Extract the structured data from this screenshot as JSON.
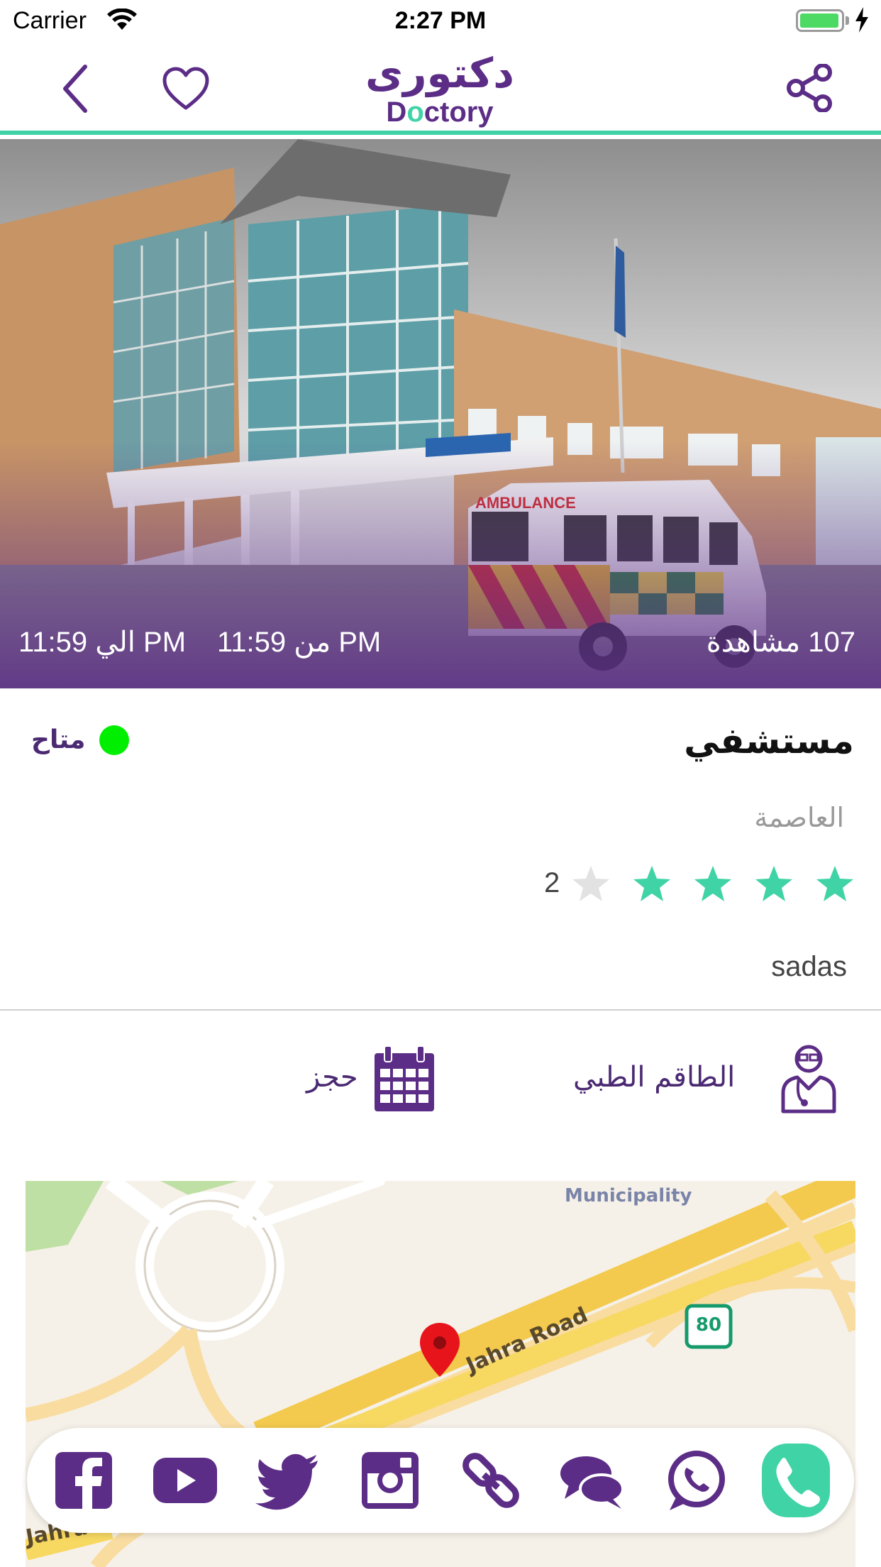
{
  "status_bar": {
    "carrier": "Carrier",
    "time": "2:27 PM"
  },
  "nav": {
    "logo_ar": "دكتورى",
    "logo_en_a": "D",
    "logo_en_dot": "o",
    "logo_en_b": "ctory",
    "icons": [
      "back-chevron-icon",
      "heart-icon",
      "share-icon"
    ]
  },
  "hero": {
    "hours_from": "من 11:59 PM",
    "hours_to": "الي 11:59 PM",
    "views": "107 مشاهدة"
  },
  "place": {
    "name": "مستشفي",
    "status": "متاح",
    "city": "العاصمة",
    "rating_value": 4,
    "rating_max": 5,
    "rating_count": "2",
    "description": "sadas"
  },
  "actions": {
    "staff_label": "الطاقم الطبي",
    "booking_label": "حجز"
  },
  "map": {
    "poi_label": "Municipality",
    "road_label": "Jahra Road",
    "road_label_2": "Jahra",
    "shield_number": "80"
  },
  "social": [
    "facebook-icon",
    "youtube-icon",
    "twitter-icon",
    "instagram-icon",
    "link-icon",
    "chat-icon",
    "whatsapp-icon",
    "phone-icon"
  ],
  "colors": {
    "brand": "#5c2d86",
    "accent": "#3fd3a6",
    "star_on": "#3fd3a6",
    "star_off": "#e2e2e2",
    "available": "#00ee00"
  }
}
